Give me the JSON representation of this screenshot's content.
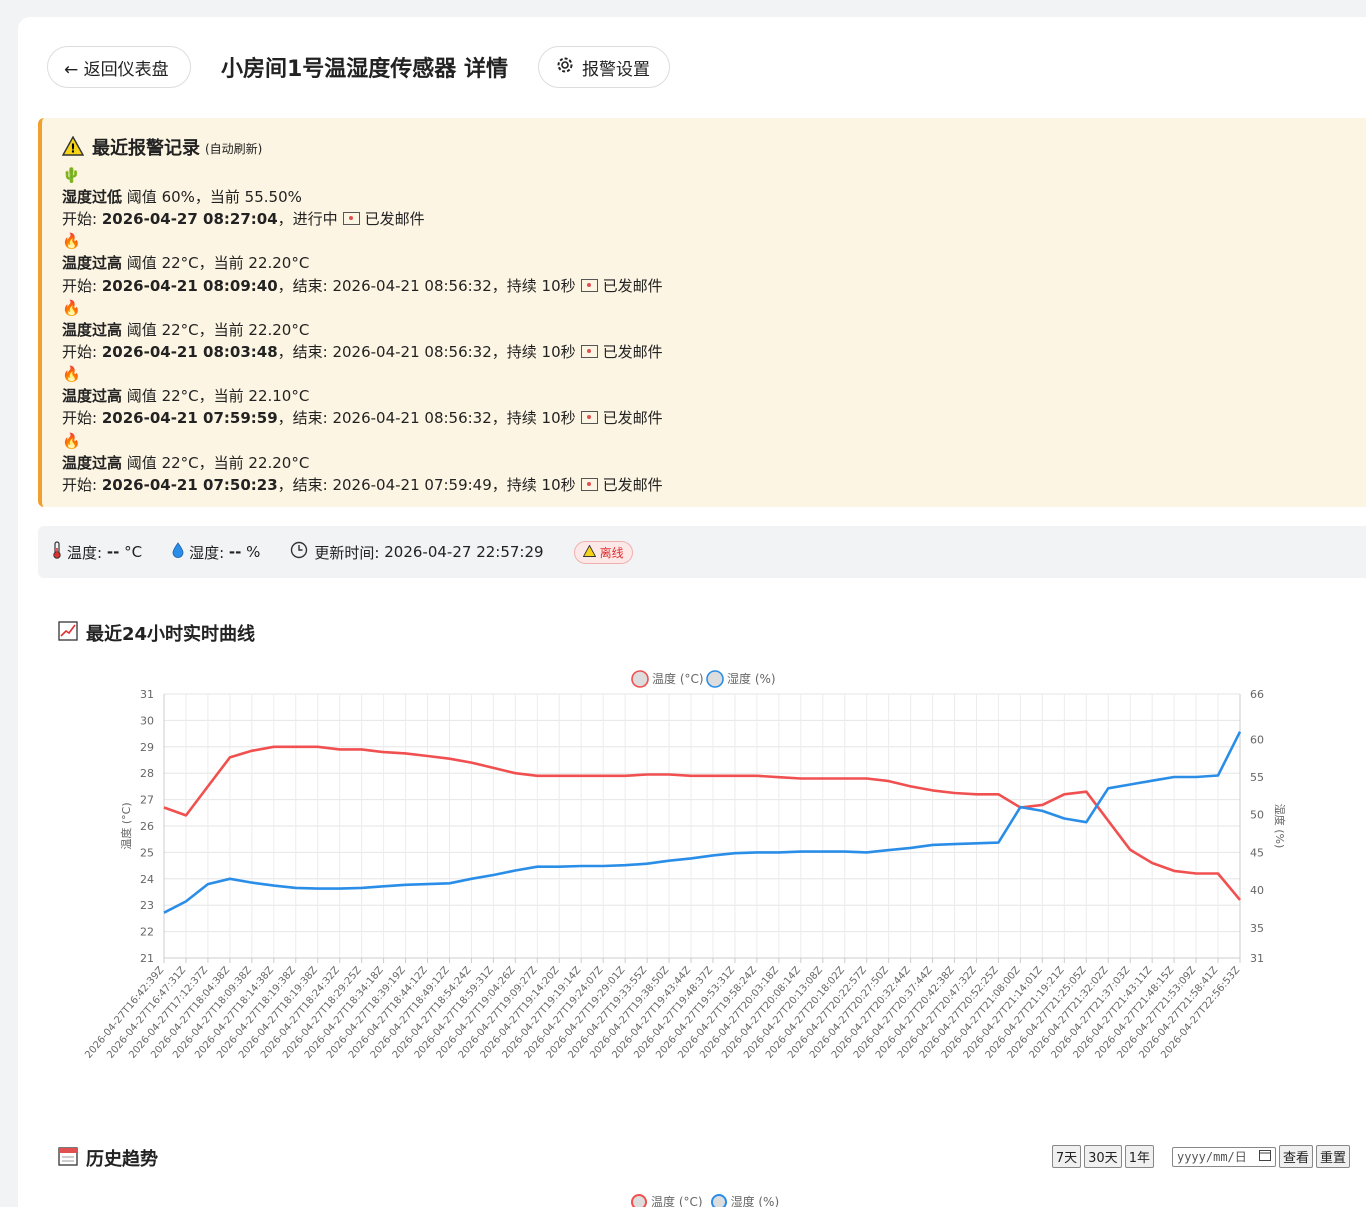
{
  "header": {
    "back_label": "← 返回仪表盘",
    "title": "小房间1号温湿度传感器 详情",
    "alarm_settings_label": "报警设置"
  },
  "alerts": {
    "title": "最近报警记录",
    "subtitle": "(自动刷新)",
    "items": [
      {
        "icon": "🌵",
        "type": "湿度过低",
        "detail": "阈值 60%，当前 55.50%",
        "start_label": "开始:",
        "start": "2026-04-27 08:27:04",
        "rest": "，进行中",
        "mail": "已发邮件"
      },
      {
        "icon": "🔥",
        "type": "温度过高",
        "detail": "阈值 22°C，当前 22.20°C",
        "start_label": "开始:",
        "start": "2026-04-21 08:09:40",
        "rest": "，结束: 2026-04-21 08:56:32，持续 10秒",
        "mail": "已发邮件"
      },
      {
        "icon": "🔥",
        "type": "温度过高",
        "detail": "阈值 22°C，当前 22.20°C",
        "start_label": "开始:",
        "start": "2026-04-21 08:03:48",
        "rest": "，结束: 2026-04-21 08:56:32，持续 10秒",
        "mail": "已发邮件"
      },
      {
        "icon": "🔥",
        "type": "温度过高",
        "detail": "阈值 22°C，当前 22.10°C",
        "start_label": "开始:",
        "start": "2026-04-21 07:59:59",
        "rest": "，结束: 2026-04-21 08:56:32，持续 10秒",
        "mail": "已发邮件"
      },
      {
        "icon": "🔥",
        "type": "温度过高",
        "detail": "阈值 22°C，当前 22.20°C",
        "start_label": "开始:",
        "start": "2026-04-21 07:50:23",
        "rest": "，结束: 2026-04-21 07:59:49，持续 10秒",
        "mail": "已发邮件"
      }
    ]
  },
  "status": {
    "temp_label": "温度:",
    "temp_value": "--",
    "temp_unit": "°C",
    "hum_label": "湿度:",
    "hum_value": "--",
    "hum_unit": "%",
    "update_label": "更新时间:",
    "update_value": "2026-04-27 22:57:29",
    "offline_label": "离线"
  },
  "realtime_title": "最近24小时实时曲线",
  "history": {
    "title": "历史趋势",
    "btn_7d": "7天",
    "btn_30d": "30天",
    "btn_1y": "1年",
    "date_placeholder": "yyyy/mm/日",
    "btn_view": "查看",
    "btn_reset": "重置"
  },
  "colors": {
    "temperature": "#f05050",
    "humidity": "#2a8ee8"
  },
  "chart_data": {
    "type": "line",
    "legend": [
      "温度 (°C)",
      "湿度 (%)"
    ],
    "legend_position": "top",
    "ylabel_left": "温度 (°C)",
    "ylabel_right": "湿度 (%)",
    "ylim_left": [
      21,
      31
    ],
    "yticks_left": [
      21,
      22,
      23,
      24,
      25,
      26,
      27,
      28,
      29,
      30,
      31
    ],
    "ylim_right": [
      31,
      66
    ],
    "yticks_right": [
      31,
      35,
      40,
      45,
      50,
      55,
      60,
      66
    ],
    "grid": true,
    "x_ticks": [
      "2026-04-27T16:42:39Z",
      "2026-04-27T16:47:31Z",
      "2026-04-27T17:12:37Z",
      "2026-04-27T18:04:38Z",
      "2026-04-27T18:09:38Z",
      "2026-04-27T18:14:38Z",
      "2026-04-27T18:19:38Z",
      "2026-04-27T18:19:38Z",
      "2026-04-27T18:24:32Z",
      "2026-04-27T18:29:25Z",
      "2026-04-27T18:34:18Z",
      "2026-04-27T18:39:19Z",
      "2026-04-27T18:44:12Z",
      "2026-04-27T18:49:12Z",
      "2026-04-27T18:54:24Z",
      "2026-04-27T18:59:31Z",
      "2026-04-27T19:04:26Z",
      "2026-04-27T19:09:27Z",
      "2026-04-27T19:14:20Z",
      "2026-04-27T19:19:14Z",
      "2026-04-27T19:24:07Z",
      "2026-04-27T19:29:01Z",
      "2026-04-27T19:33:55Z",
      "2026-04-27T19:38:50Z",
      "2026-04-27T19:43:44Z",
      "2026-04-27T19:48:37Z",
      "2026-04-27T19:53:31Z",
      "2026-04-27T19:58:24Z",
      "2026-04-27T20:03:18Z",
      "2026-04-27T20:08:14Z",
      "2026-04-27T20:13:08Z",
      "2026-04-27T20:18:02Z",
      "2026-04-27T20:22:57Z",
      "2026-04-27T20:27:50Z",
      "2026-04-27T20:32:44Z",
      "2026-04-27T20:37:44Z",
      "2026-04-27T20:42:38Z",
      "2026-04-27T20:47:32Z",
      "2026-04-27T20:52:25Z",
      "2026-04-27T21:08:00Z",
      "2026-04-27T21:14:01Z",
      "2026-04-27T21:19:21Z",
      "2026-04-27T21:25:05Z",
      "2026-04-27T21:32:02Z",
      "2026-04-27T21:37:03Z",
      "2026-04-27T21:43:11Z",
      "2026-04-27T21:48:15Z",
      "2026-04-27T21:53:09Z",
      "2026-04-27T21:58:41Z",
      "2026-04-27T22:56:53Z"
    ],
    "series": [
      {
        "name": "温度 (°C)",
        "axis": "left",
        "values": [
          26.7,
          26.4,
          27.5,
          28.6,
          28.85,
          29.0,
          29.0,
          29.0,
          28.9,
          28.9,
          28.8,
          28.75,
          28.65,
          28.55,
          28.4,
          28.2,
          28.0,
          27.9,
          27.9,
          27.9,
          27.9,
          27.9,
          27.95,
          27.95,
          27.9,
          27.9,
          27.9,
          27.9,
          27.85,
          27.8,
          27.8,
          27.8,
          27.8,
          27.7,
          27.5,
          27.35,
          27.25,
          27.2,
          27.2,
          26.7,
          26.8,
          27.2,
          27.3,
          26.2,
          25.1,
          24.6,
          24.3,
          24.2,
          24.2,
          23.2
        ]
      },
      {
        "name": "湿度 (%)",
        "axis": "left_scaled",
        "values": [
          37.0,
          38.5,
          40.8,
          41.5,
          41.0,
          40.6,
          40.3,
          40.2,
          40.2,
          40.3,
          40.5,
          40.7,
          40.8,
          40.9,
          41.5,
          42.0,
          42.6,
          43.1,
          43.1,
          43.2,
          43.2,
          43.3,
          43.5,
          43.9,
          44.2,
          44.6,
          44.9,
          45.0,
          45.0,
          45.1,
          45.1,
          45.1,
          45.0,
          45.3,
          45.6,
          46.0,
          46.1,
          46.2,
          46.3,
          51.0,
          50.5,
          49.5,
          49.0,
          53.5,
          54.0,
          54.5,
          55.0,
          55.0,
          55.2,
          61.0
        ]
      }
    ]
  }
}
